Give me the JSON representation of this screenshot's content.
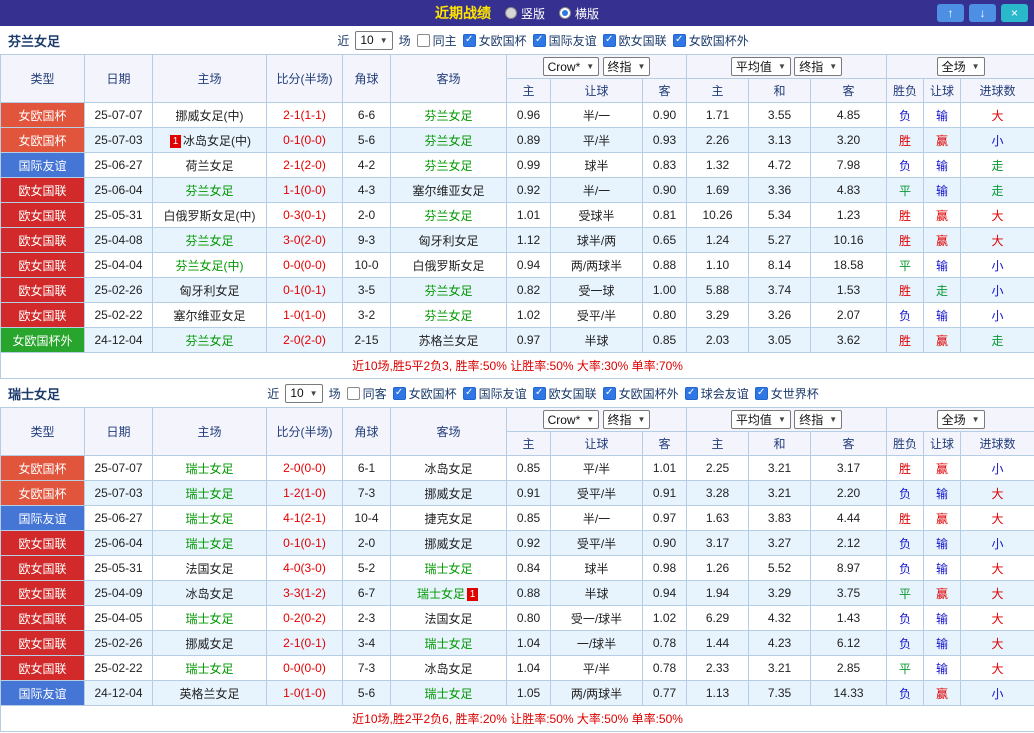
{
  "titlebar": {
    "title": "近期战绩",
    "radios": [
      {
        "label": "竖版",
        "selected": false
      },
      {
        "label": "横版",
        "selected": true
      }
    ]
  },
  "icons": {
    "up": "↑",
    "down": "↓",
    "close": "×",
    "dropdown_arrow": "▼",
    "check": "✓"
  },
  "labels": {
    "near": "近",
    "games": "场"
  },
  "header": {
    "cols": {
      "type": "类型",
      "date": "日期",
      "home": "主场",
      "score": "比分(半场)",
      "corner": "角球",
      "away": "客场"
    },
    "dropdowns": {
      "company": "Crow*",
      "final1": "终指",
      "avg": "平均值",
      "final2": "终指",
      "full": "全场"
    },
    "sub": [
      "主",
      "让球",
      "客",
      "主",
      "和",
      "客",
      "胜负",
      "让球",
      "进球数"
    ]
  },
  "type_colors": {
    "女欧国杯": "#e2553d",
    "国际友谊": "#4575d5",
    "欧女国联": "#d22a2a",
    "女欧国杯外": "#27a52c"
  },
  "result_colors": {
    "red": "#e10000",
    "blue": "#1414cc",
    "green": "#089933"
  },
  "sections": [
    {
      "team": "芬兰女足",
      "near_count": "10",
      "same_label": "同主",
      "same_checked": false,
      "competitions": [
        {
          "label": "女欧国杯",
          "checked": true
        },
        {
          "label": "国际友谊",
          "checked": true
        },
        {
          "label": "欧女国联",
          "checked": true
        },
        {
          "label": "女欧国杯外",
          "checked": true
        }
      ],
      "rows": [
        {
          "type": "女欧国杯",
          "date": "25-07-07",
          "home": "挪威女足(中)",
          "home_focus": false,
          "score": "2-1(1-1)",
          "corner": "6-6",
          "away": "芬兰女足",
          "away_focus": true,
          "odds": [
            "0.96",
            "半/一",
            "0.90",
            "1.71",
            "3.55",
            "4.85"
          ],
          "results": [
            [
              "负",
              "blue"
            ],
            [
              "输",
              "blue"
            ],
            [
              "大",
              "red"
            ]
          ]
        },
        {
          "type": "女欧国杯",
          "date": "25-07-03",
          "home": "冰岛女足(中)",
          "home_focus": false,
          "home_badge": "1",
          "home_badge_pos": "before",
          "score": "0-1(0-0)",
          "corner": "5-6",
          "away": "芬兰女足",
          "away_focus": true,
          "odds": [
            "0.89",
            "平/半",
            "0.93",
            "2.26",
            "3.13",
            "3.20"
          ],
          "results": [
            [
              "胜",
              "red"
            ],
            [
              "赢",
              "red"
            ],
            [
              "小",
              "blue"
            ]
          ]
        },
        {
          "type": "国际友谊",
          "date": "25-06-27",
          "home": "荷兰女足",
          "home_focus": false,
          "score": "2-1(2-0)",
          "corner": "4-2",
          "away": "芬兰女足",
          "away_focus": true,
          "odds": [
            "0.99",
            "球半",
            "0.83",
            "1.32",
            "4.72",
            "7.98"
          ],
          "results": [
            [
              "负",
              "blue"
            ],
            [
              "输",
              "blue"
            ],
            [
              "走",
              "green"
            ]
          ]
        },
        {
          "type": "欧女国联",
          "date": "25-06-04",
          "home": "芬兰女足",
          "home_focus": true,
          "score": "1-1(0-0)",
          "corner": "4-3",
          "away": "塞尔维亚女足",
          "away_focus": false,
          "odds": [
            "0.92",
            "半/一",
            "0.90",
            "1.69",
            "3.36",
            "4.83"
          ],
          "results": [
            [
              "平",
              "green"
            ],
            [
              "输",
              "blue"
            ],
            [
              "走",
              "green"
            ]
          ]
        },
        {
          "type": "欧女国联",
          "date": "25-05-31",
          "home": "白俄罗斯女足(中)",
          "home_focus": false,
          "score": "0-3(0-1)",
          "corner": "2-0",
          "away": "芬兰女足",
          "away_focus": true,
          "odds": [
            "1.01",
            "受球半",
            "0.81",
            "10.26",
            "5.34",
            "1.23"
          ],
          "results": [
            [
              "胜",
              "red"
            ],
            [
              "赢",
              "red"
            ],
            [
              "大",
              "red"
            ]
          ]
        },
        {
          "type": "欧女国联",
          "date": "25-04-08",
          "home": "芬兰女足",
          "home_focus": true,
          "score": "3-0(2-0)",
          "corner": "9-3",
          "away": "匈牙利女足",
          "away_focus": false,
          "odds": [
            "1.12",
            "球半/两",
            "0.65",
            "1.24",
            "5.27",
            "10.16"
          ],
          "results": [
            [
              "胜",
              "red"
            ],
            [
              "赢",
              "red"
            ],
            [
              "大",
              "red"
            ]
          ]
        },
        {
          "type": "欧女国联",
          "date": "25-04-04",
          "home": "芬兰女足(中)",
          "home_focus": true,
          "score": "0-0(0-0)",
          "corner": "10-0",
          "away": "白俄罗斯女足",
          "away_focus": false,
          "odds": [
            "0.94",
            "两/两球半",
            "0.88",
            "1.10",
            "8.14",
            "18.58"
          ],
          "results": [
            [
              "平",
              "green"
            ],
            [
              "输",
              "blue"
            ],
            [
              "小",
              "blue"
            ]
          ]
        },
        {
          "type": "欧女国联",
          "date": "25-02-26",
          "home": "匈牙利女足",
          "home_focus": false,
          "score": "0-1(0-1)",
          "corner": "3-5",
          "away": "芬兰女足",
          "away_focus": true,
          "odds": [
            "0.82",
            "受一球",
            "1.00",
            "5.88",
            "3.74",
            "1.53"
          ],
          "results": [
            [
              "胜",
              "red"
            ],
            [
              "走",
              "green"
            ],
            [
              "小",
              "blue"
            ]
          ]
        },
        {
          "type": "欧女国联",
          "date": "25-02-22",
          "home": "塞尔维亚女足",
          "home_focus": false,
          "score": "1-0(1-0)",
          "corner": "3-2",
          "away": "芬兰女足",
          "away_focus": true,
          "odds": [
            "1.02",
            "受平/半",
            "0.80",
            "3.29",
            "3.26",
            "2.07"
          ],
          "results": [
            [
              "负",
              "blue"
            ],
            [
              "输",
              "blue"
            ],
            [
              "小",
              "blue"
            ]
          ]
        },
        {
          "type": "女欧国杯外",
          "date": "24-12-04",
          "home": "芬兰女足",
          "home_focus": true,
          "score": "2-0(2-0)",
          "corner": "2-15",
          "away": "苏格兰女足",
          "away_focus": false,
          "odds": [
            "0.97",
            "半球",
            "0.85",
            "2.03",
            "3.05",
            "3.62"
          ],
          "results": [
            [
              "胜",
              "red"
            ],
            [
              "赢",
              "red"
            ],
            [
              "走",
              "green"
            ]
          ]
        }
      ],
      "summary": "近10场,胜5平2负3, 胜率:50% 让胜率:50% 大率:30% 单率:70%"
    },
    {
      "team": "瑞士女足",
      "near_count": "10",
      "same_label": "同客",
      "same_checked": false,
      "competitions": [
        {
          "label": "女欧国杯",
          "checked": true
        },
        {
          "label": "国际友谊",
          "checked": true
        },
        {
          "label": "欧女国联",
          "checked": true
        },
        {
          "label": "女欧国杯外",
          "checked": true
        },
        {
          "label": "球会友谊",
          "checked": true
        },
        {
          "label": "女世界杯",
          "checked": true
        }
      ],
      "rows": [
        {
          "type": "女欧国杯",
          "date": "25-07-07",
          "home": "瑞士女足",
          "home_focus": true,
          "score": "2-0(0-0)",
          "corner": "6-1",
          "away": "冰岛女足",
          "away_focus": false,
          "odds": [
            "0.85",
            "平/半",
            "1.01",
            "2.25",
            "3.21",
            "3.17"
          ],
          "results": [
            [
              "胜",
              "red"
            ],
            [
              "赢",
              "red"
            ],
            [
              "小",
              "blue"
            ]
          ]
        },
        {
          "type": "女欧国杯",
          "date": "25-07-03",
          "home": "瑞士女足",
          "home_focus": true,
          "score": "1-2(1-0)",
          "corner": "7-3",
          "away": "挪威女足",
          "away_focus": false,
          "odds": [
            "0.91",
            "受平/半",
            "0.91",
            "3.28",
            "3.21",
            "2.20"
          ],
          "results": [
            [
              "负",
              "blue"
            ],
            [
              "输",
              "blue"
            ],
            [
              "大",
              "red"
            ]
          ]
        },
        {
          "type": "国际友谊",
          "date": "25-06-27",
          "home": "瑞士女足",
          "home_focus": true,
          "score": "4-1(2-1)",
          "corner": "10-4",
          "away": "捷克女足",
          "away_focus": false,
          "odds": [
            "0.85",
            "半/一",
            "0.97",
            "1.63",
            "3.83",
            "4.44"
          ],
          "results": [
            [
              "胜",
              "red"
            ],
            [
              "赢",
              "red"
            ],
            [
              "大",
              "red"
            ]
          ]
        },
        {
          "type": "欧女国联",
          "date": "25-06-04",
          "home": "瑞士女足",
          "home_focus": true,
          "score": "0-1(0-1)",
          "corner": "2-0",
          "away": "挪威女足",
          "away_focus": false,
          "odds": [
            "0.92",
            "受平/半",
            "0.90",
            "3.17",
            "3.27",
            "2.12"
          ],
          "results": [
            [
              "负",
              "blue"
            ],
            [
              "输",
              "blue"
            ],
            [
              "小",
              "blue"
            ]
          ]
        },
        {
          "type": "欧女国联",
          "date": "25-05-31",
          "home": "法国女足",
          "home_focus": false,
          "score": "4-0(3-0)",
          "corner": "5-2",
          "away": "瑞士女足",
          "away_focus": true,
          "odds": [
            "0.84",
            "球半",
            "0.98",
            "1.26",
            "5.52",
            "8.97"
          ],
          "results": [
            [
              "负",
              "blue"
            ],
            [
              "输",
              "blue"
            ],
            [
              "大",
              "red"
            ]
          ]
        },
        {
          "type": "欧女国联",
          "date": "25-04-09",
          "home": "冰岛女足",
          "home_focus": false,
          "score": "3-3(1-2)",
          "corner": "6-7",
          "away": "瑞士女足",
          "away_focus": true,
          "away_badge": "1",
          "away_badge_pos": "after",
          "odds": [
            "0.88",
            "半球",
            "0.94",
            "1.94",
            "3.29",
            "3.75"
          ],
          "results": [
            [
              "平",
              "green"
            ],
            [
              "赢",
              "red"
            ],
            [
              "大",
              "red"
            ]
          ]
        },
        {
          "type": "欧女国联",
          "date": "25-04-05",
          "home": "瑞士女足",
          "home_focus": true,
          "score": "0-2(0-2)",
          "corner": "2-3",
          "away": "法国女足",
          "away_focus": false,
          "odds": [
            "0.80",
            "受一/球半",
            "1.02",
            "6.29",
            "4.32",
            "1.43"
          ],
          "results": [
            [
              "负",
              "blue"
            ],
            [
              "输",
              "blue"
            ],
            [
              "大",
              "red"
            ]
          ]
        },
        {
          "type": "欧女国联",
          "date": "25-02-26",
          "home": "挪威女足",
          "home_focus": false,
          "score": "2-1(0-1)",
          "corner": "3-4",
          "away": "瑞士女足",
          "away_focus": true,
          "odds": [
            "1.04",
            "一/球半",
            "0.78",
            "1.44",
            "4.23",
            "6.12"
          ],
          "results": [
            [
              "负",
              "blue"
            ],
            [
              "输",
              "blue"
            ],
            [
              "大",
              "red"
            ]
          ]
        },
        {
          "type": "欧女国联",
          "date": "25-02-22",
          "home": "瑞士女足",
          "home_focus": true,
          "score": "0-0(0-0)",
          "corner": "7-3",
          "away": "冰岛女足",
          "away_focus": false,
          "odds": [
            "1.04",
            "平/半",
            "0.78",
            "2.33",
            "3.21",
            "2.85"
          ],
          "results": [
            [
              "平",
              "green"
            ],
            [
              "输",
              "blue"
            ],
            [
              "大",
              "red"
            ]
          ]
        },
        {
          "type": "国际友谊",
          "date": "24-12-04",
          "home": "英格兰女足",
          "home_focus": false,
          "score": "1-0(1-0)",
          "corner": "5-6",
          "away": "瑞士女足",
          "away_focus": true,
          "odds": [
            "1.05",
            "两/两球半",
            "0.77",
            "1.13",
            "7.35",
            "14.33"
          ],
          "results": [
            [
              "负",
              "blue"
            ],
            [
              "赢",
              "red"
            ],
            [
              "小",
              "blue"
            ]
          ]
        }
      ],
      "summary": "近10场,胜2平2负6, 胜率:20% 让胜率:50% 大率:50% 单率:50%"
    }
  ]
}
